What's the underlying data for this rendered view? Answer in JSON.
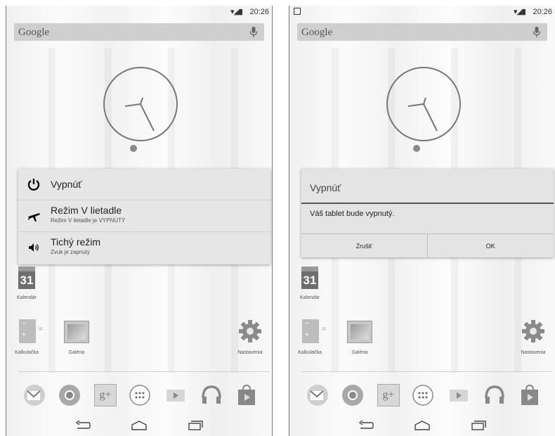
{
  "status_bar": {
    "time": "20:26",
    "icons": "▾◢▮"
  },
  "search": {
    "label": "Google"
  },
  "menu": {
    "items": [
      {
        "title": "Vypnúť",
        "subtitle": ""
      },
      {
        "title": "Režim V lietadle",
        "subtitle": "Režim V lietadle je VYPNUTÝ"
      },
      {
        "title": "Tichý režim",
        "subtitle": "Zvuk je zapnutý"
      }
    ]
  },
  "dialog": {
    "title": "Vypnúť",
    "message": "Váš tablet bude vypnutý.",
    "cancel": "Zrušiť",
    "ok": "OK"
  },
  "apps": {
    "calendar": {
      "label": "Kalendár",
      "day": "31"
    },
    "calculator": {
      "label": "Kalkulačka"
    },
    "gallery": {
      "label": "Galéria"
    },
    "settings": {
      "label": "Nastavenia"
    }
  },
  "dock": [
    "gmail-icon",
    "chrome-icon",
    "google-plus-icon",
    "app-drawer-icon",
    "play-movies-icon",
    "play-music-icon",
    "play-store-icon"
  ],
  "dock_text": {
    "gplus": "g+"
  }
}
